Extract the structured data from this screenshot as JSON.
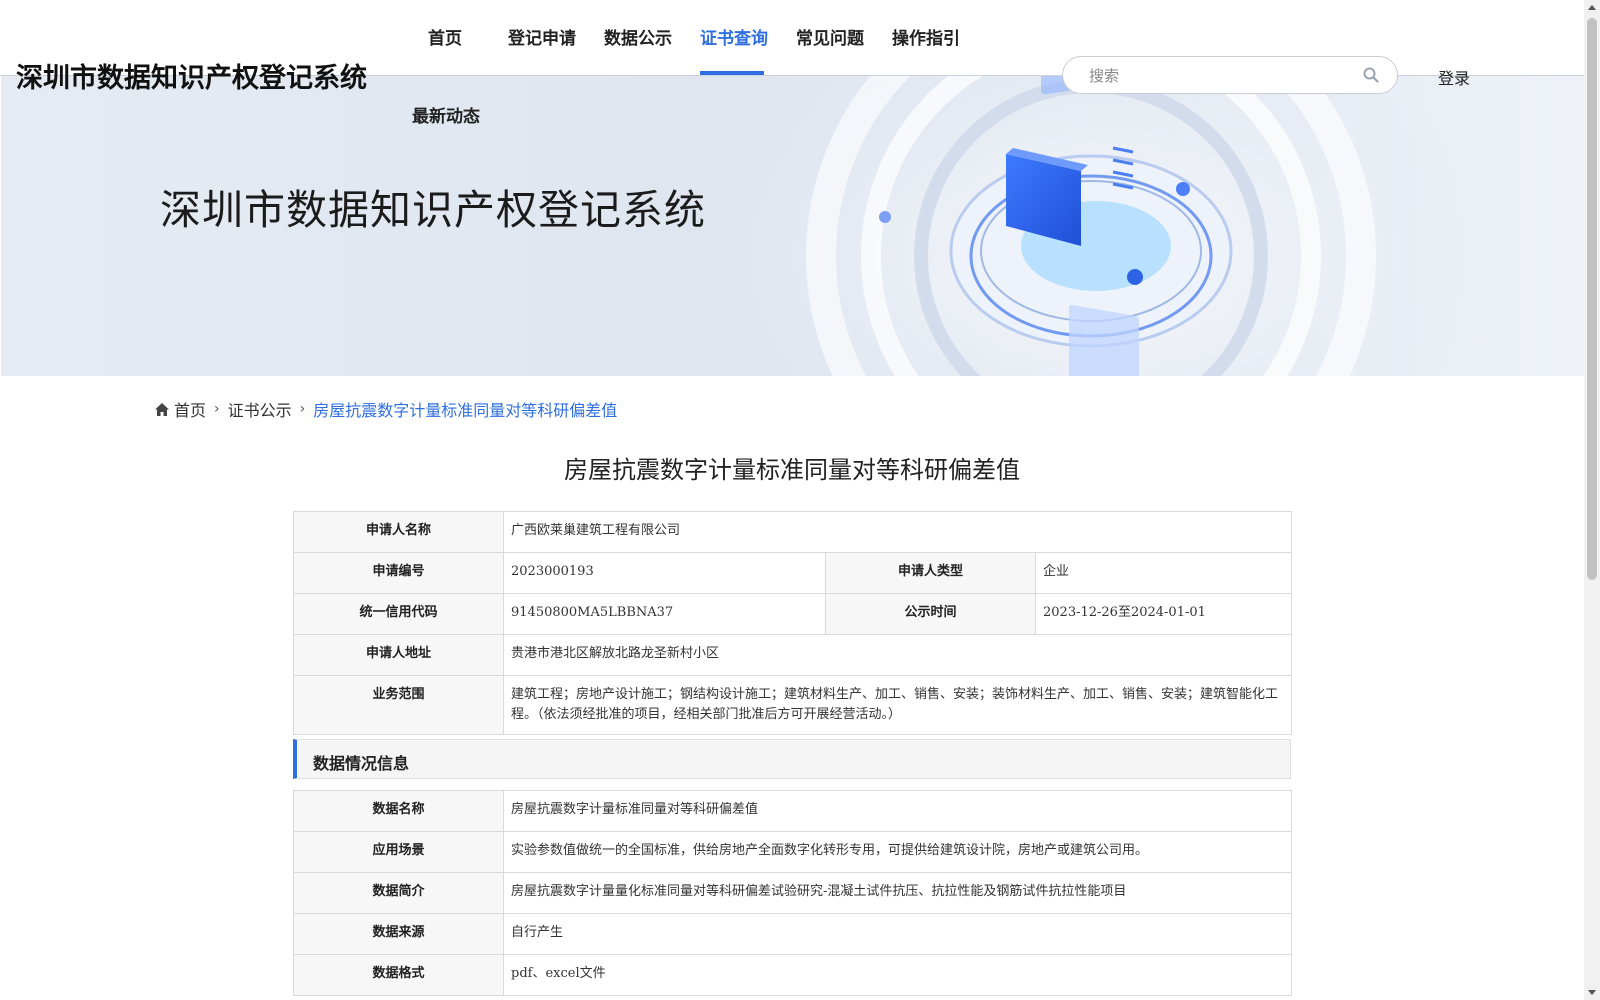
{
  "header": {
    "site_title": "深圳市数据知识产权登记系统",
    "nav": [
      "首页",
      "登记申请",
      "数据公示",
      "证书查询",
      "常见问题",
      "操作指引",
      "最新动态"
    ],
    "active_nav": "证书查询",
    "search_placeholder": "搜索",
    "login_label": "登录",
    "accent_color": "#2f6fe0"
  },
  "banner": {
    "title": "深圳市数据知识产权登记系统"
  },
  "breadcrumb": {
    "home": "首页",
    "section": "证书公示",
    "current": "房屋抗震数字计量标准同量对等科研偏差值"
  },
  "detail": {
    "title": "房屋抗震数字计量标准同量对等科研偏差值",
    "applicant": {
      "name_label": "申请人名称",
      "name": "广西欧莱巢建筑工程有限公司",
      "number_label": "申请编号",
      "number": "2023000193",
      "type_label": "申请人类型",
      "type": "企业",
      "credit_label": "统一信用代码",
      "credit": "91450800MA5LBBNA37",
      "period_label": "公示时间",
      "period": "2023-12-26至2024-01-01",
      "address_label": "申请人地址",
      "address": "贵港市港北区解放北路龙圣新村小区",
      "scope_label": "业务范围",
      "scope": "建筑工程；房地产设计施工；钢结构设计施工；建筑材料生产、加工、销售、安装；装饰材料生产、加工、销售、安装；建筑智能化工程。（依法须经批准的项目，经相关部门批准后方可开展经营活动。）"
    },
    "data_section_title": "数据情况信息",
    "data_info": [
      {
        "label": "数据名称",
        "value": "房屋抗震数字计量标准同量对等科研偏差值"
      },
      {
        "label": "应用场景",
        "value": "实验参数值做统一的全国标准，供给房地产全面数字化转形专用，可提供给建筑设计院，房地产或建筑公司用。"
      },
      {
        "label": "数据简介",
        "value": "房屋抗震数字计量量化标准同量对等科研偏差试验研究-混凝土试件抗压、抗拉性能及钢筋试件抗拉性能项目"
      },
      {
        "label": "数据来源",
        "value": "自行产生"
      },
      {
        "label": "数据格式",
        "value": "pdf、excel文件"
      }
    ]
  }
}
